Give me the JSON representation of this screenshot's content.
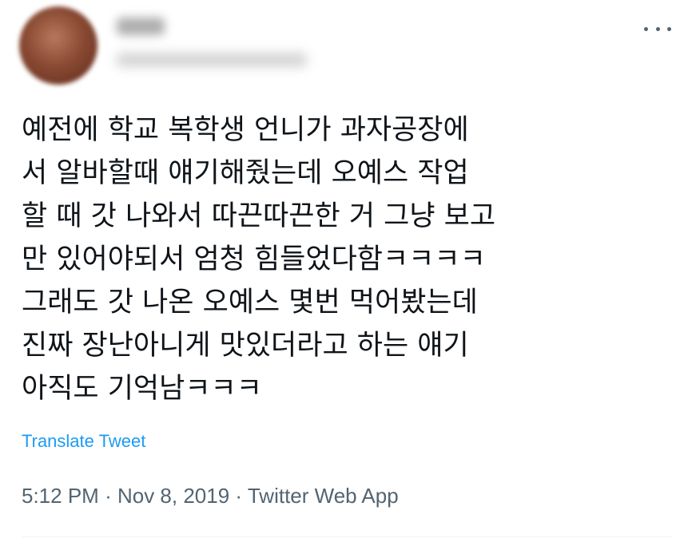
{
  "tweet": {
    "text_lines": [
      "예전에 학교 복학생 언니가 과자공장에",
      "서 알바할때 얘기해줬는데 오예스 작업",
      "할 때 갓 나와서 따끈따끈한 거 그냥 보고",
      "만 있어야되서 엄청 힘들었다함ㅋㅋㅋㅋ",
      "그래도 갓 나온 오예스 몇번 먹어봤는데",
      "진짜 장난아니게 맛있더라고 하는 얘기",
      "아직도 기억남ㅋㅋㅋ"
    ],
    "translate_label": "Translate Tweet",
    "time": "5:12 PM",
    "separator": "·",
    "date": "Nov 8, 2019",
    "source": "Twitter Web App"
  },
  "icons": {
    "more": "more-horizontal-icon"
  },
  "colors": {
    "text": "#0f1419",
    "link": "#1d9bf0",
    "secondary": "#536471"
  }
}
